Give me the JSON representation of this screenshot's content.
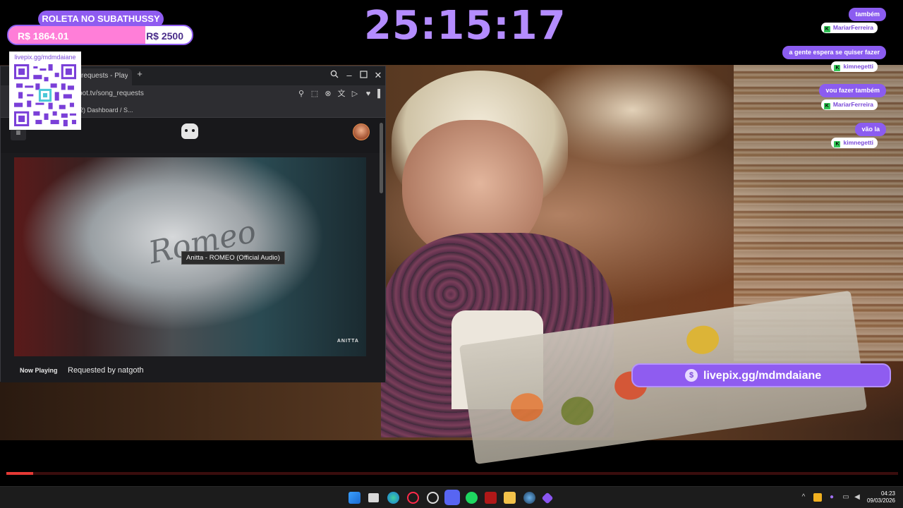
{
  "overlay": {
    "roleta_title": "ROLETA NO SUBATHUSSY",
    "goal_current": "R$ 1864.01",
    "goal_target": "R$ 2500",
    "goal_fraction": 0.7456,
    "timer": "25:15:17",
    "qr_url": "livepix.gg/mdmdaiane",
    "livepix_banner": "livepix.gg/mdmdaiane"
  },
  "browser": {
    "tab_label": "requests - Playin",
    "address": "pot.tv/song_requests",
    "bookmark": "2) Dashboard / S..."
  },
  "player": {
    "tooltip": "Anitta - ROMEO (Official Audio)",
    "art_script": "Romeo",
    "art_brand": "ANITTA",
    "now_playing_label": "Now Playing",
    "requested_by": "Requested by natgoth"
  },
  "chat": [
    {
      "message": "também",
      "user": "MariarFerreira"
    },
    {
      "message": "a gente espera se quiser fazer",
      "user": "kimnegetti"
    },
    {
      "message": "vou fazer também",
      "user": "MariarFerreira"
    },
    {
      "message": "vão la",
      "user": "kimnegetti"
    }
  ],
  "video_progress": 0.03,
  "taskbar": {
    "time": "04:23",
    "date": "09/03/2026",
    "icons": [
      "windows-start-icon",
      "task-view-icon",
      "edge-icon",
      "opera-gx-icon",
      "obs-icon",
      "discord-icon",
      "spotify-icon",
      "voicemod-icon",
      "file-explorer-icon",
      "steam-icon",
      "twitch-studio-icon"
    ]
  },
  "colors": {
    "accent_purple": "#8f5cf0",
    "timer_purple": "#b48cff",
    "goal_pink": "#ff7ed8",
    "progress_red": "#e53935"
  }
}
